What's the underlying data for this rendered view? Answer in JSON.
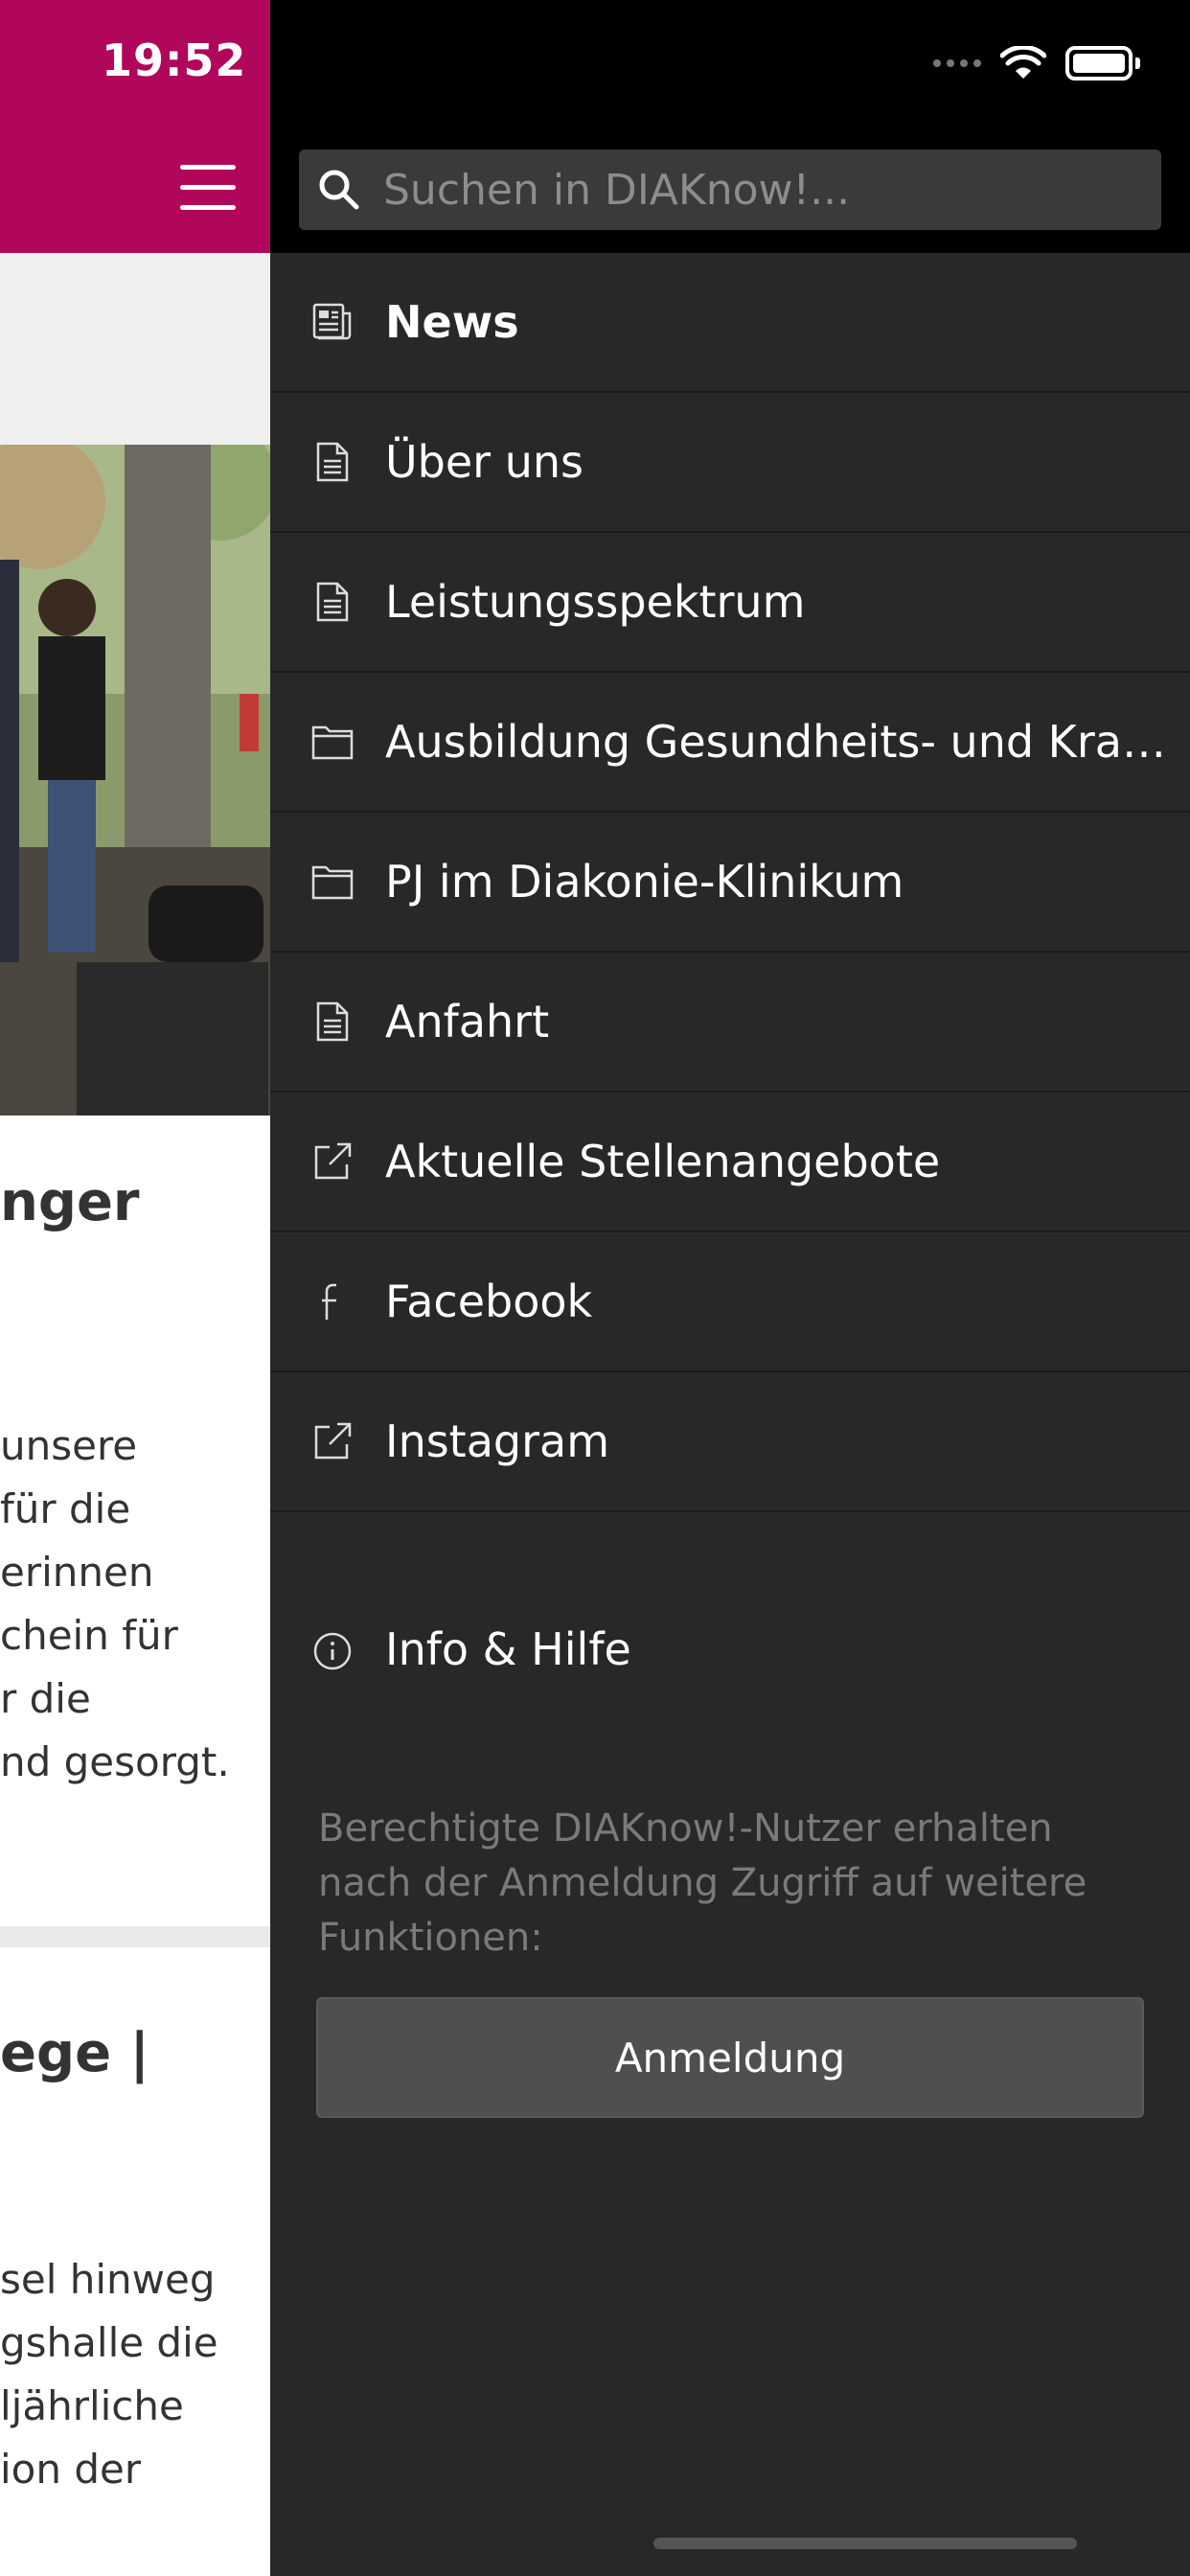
{
  "status_bar": {
    "time": "19:52"
  },
  "search": {
    "placeholder": "Suchen in DIAKnow!..."
  },
  "menu": {
    "items": [
      {
        "label": "News",
        "icon": "newspaper-icon"
      },
      {
        "label": "Über uns",
        "icon": "document-icon"
      },
      {
        "label": "Leistungsspektrum",
        "icon": "document-icon"
      },
      {
        "label": "Ausbildung Gesundheits- und Kranke...",
        "icon": "folder-icon"
      },
      {
        "label": "PJ im Diakonie-Klinikum",
        "icon": "folder-icon"
      },
      {
        "label": "Anfahrt",
        "icon": "document-icon"
      },
      {
        "label": "Aktuelle Stellenangebote",
        "icon": "external-link-icon"
      },
      {
        "label": "Facebook",
        "icon": "facebook-icon"
      },
      {
        "label": "Instagram",
        "icon": "external-link-icon"
      }
    ]
  },
  "info": {
    "label": "Info & Hilfe",
    "icon": "info-icon"
  },
  "login": {
    "hint": "Berechtigte DIAKnow!-Nutzer erhalten nach der Anmeldung Zugriff auf weitere Funktionen:",
    "button_label": "Anmeldung"
  },
  "background_article": {
    "heading1_fragment": "nger",
    "paragraph1_lines": [
      "unsere",
      "für die",
      "erinnen",
      "chein für",
      "r die",
      "nd gesorgt."
    ],
    "heading2_fragment": "ege |",
    "paragraph2_lines": [
      "sel hinweg",
      "gshalle die",
      "ljährliche",
      "ion der"
    ]
  },
  "colors": {
    "brand": "#b0075a",
    "drawer_bg": "#282828",
    "search_bg": "#3a3a3a"
  }
}
